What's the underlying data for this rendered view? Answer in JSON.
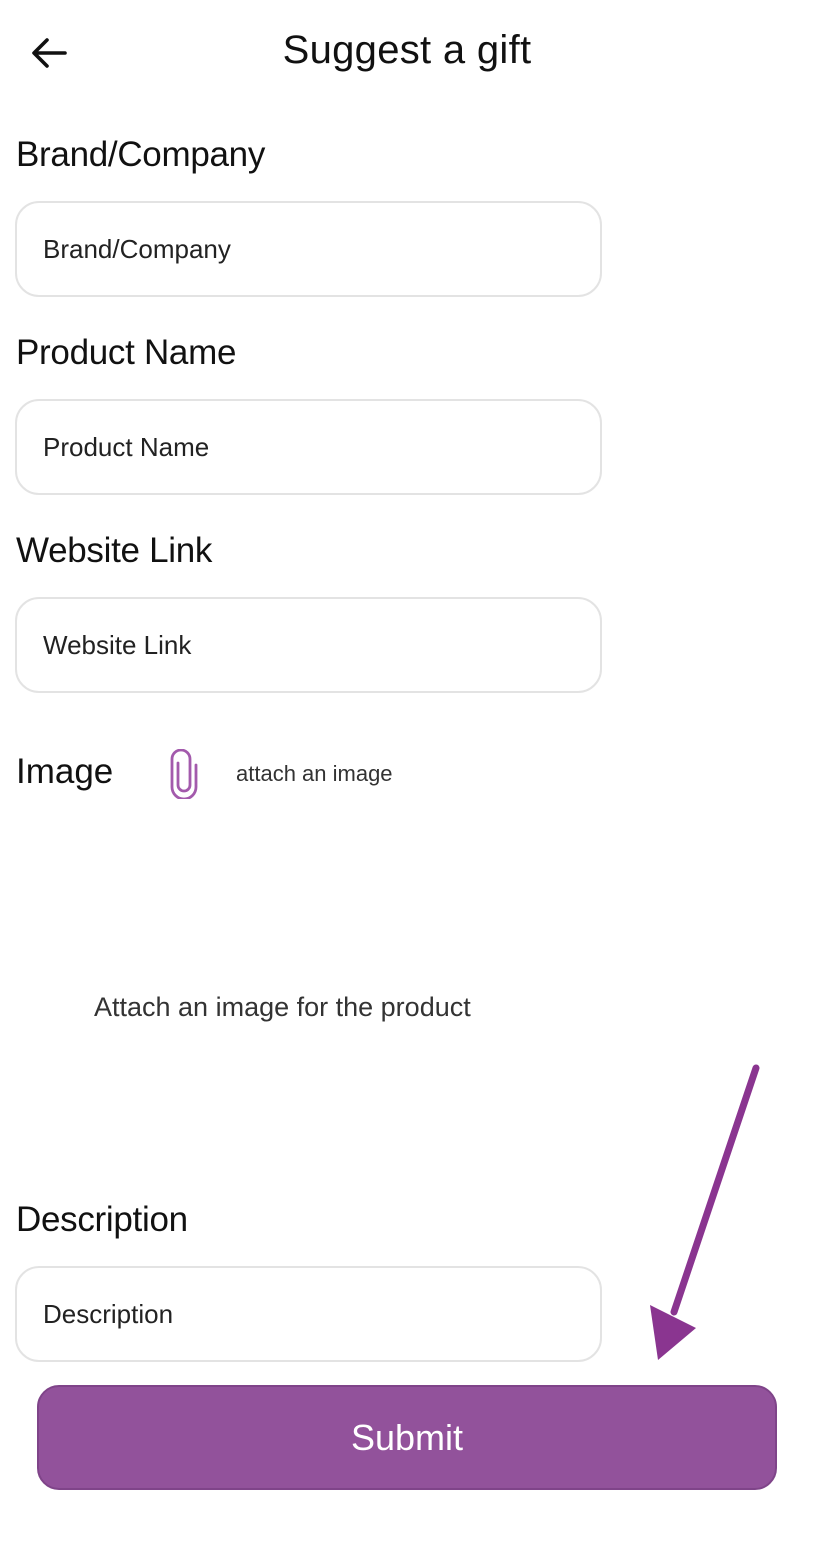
{
  "header": {
    "title": "Suggest a gift",
    "back_icon": "arrow-left-icon"
  },
  "form": {
    "brand": {
      "label": "Brand/Company",
      "placeholder": "Brand/Company",
      "value": ""
    },
    "product": {
      "label": "Product Name",
      "placeholder": "Product Name",
      "value": ""
    },
    "website": {
      "label": "Website Link",
      "placeholder": "Website Link",
      "value": ""
    },
    "image": {
      "label": "Image",
      "attach_icon": "paperclip-icon",
      "attach_text": "attach an image",
      "placeholder_text": "Attach an image for the product"
    },
    "description": {
      "label": "Description",
      "placeholder": "Description",
      "value": ""
    },
    "submit_label": "Submit"
  },
  "colors": {
    "accent": "#92529b",
    "arrow": "#8a3590",
    "input_border": "#e3e3e3"
  }
}
